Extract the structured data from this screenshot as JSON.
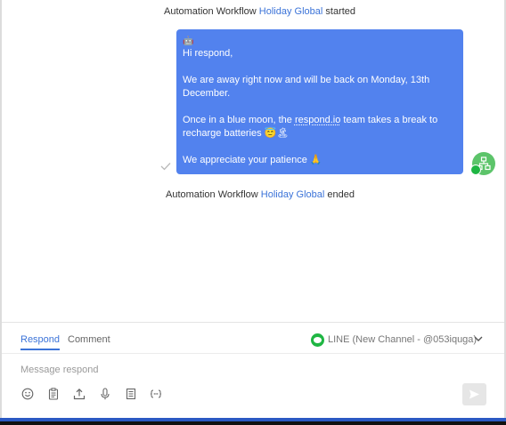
{
  "chat": {
    "started": {
      "prefix": "Automation Workflow",
      "workflow": "Holiday Global",
      "suffix": "started"
    },
    "ended": {
      "prefix": "Automation Workflow",
      "workflow": "Holiday Global",
      "suffix": "ended"
    },
    "message": {
      "top_emoji": "🤖",
      "greeting": "Hi respond,",
      "line1": "We are away right now and will be back on Monday, 13th December.",
      "line2_before": "Once in a blue moon, the",
      "line2_link": "respond.io",
      "line2_after": "team takes a break to recharge batteries 😇🏝",
      "line3": "We appreciate your patience 🙏"
    },
    "status_icon": "check-icon",
    "sender_icon": "workflow-bot-icon",
    "channel_badge_icon": "line-icon"
  },
  "composer": {
    "tabs": [
      {
        "label": "Respond",
        "active": true
      },
      {
        "label": "Comment",
        "active": false
      }
    ],
    "channel": "LINE (New Channel - @053iquga)",
    "placeholder": "Message respond",
    "tools": [
      "emoji-icon",
      "clipboard-icon",
      "upload-icon",
      "microphone-icon",
      "snippet-icon",
      "variable-icon"
    ],
    "send_icon": "send-icon"
  },
  "colors": {
    "accent": "#3b73d8",
    "bubble": "#5282ee",
    "line_green": "#1fb643",
    "bot_green": "#5cc46a"
  }
}
